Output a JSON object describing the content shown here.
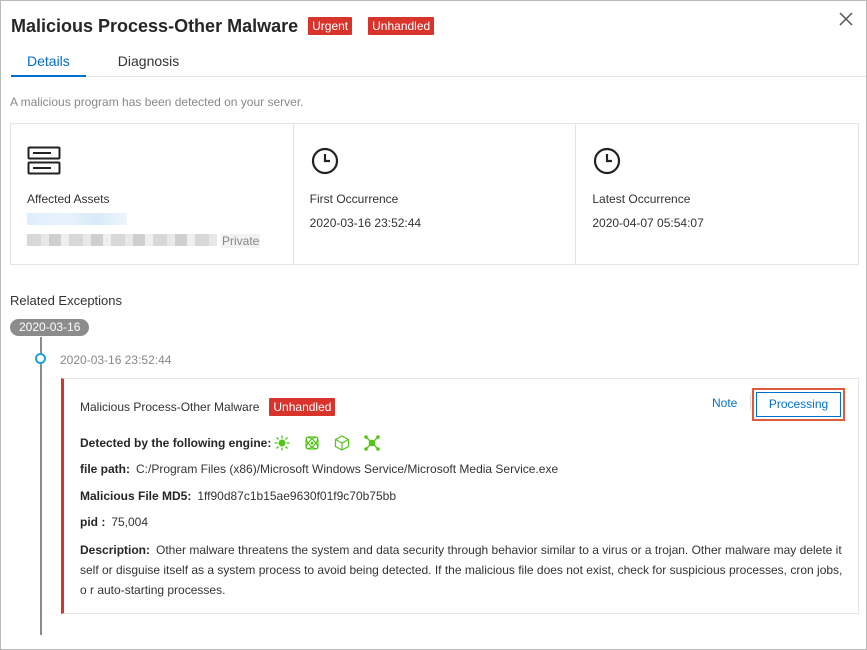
{
  "dialog": {
    "title": "Malicious Process-Other Malware",
    "badges": [
      "Urgent",
      "Unhandled"
    ],
    "close_icon": "close-icon"
  },
  "tabs": [
    {
      "label": "Details",
      "active": true
    },
    {
      "label": "Diagnosis",
      "active": false
    }
  ],
  "description": "A malicious program has been detected on your server.",
  "cards": {
    "affected": {
      "label": "Affected Assets",
      "tag": "Private",
      "icon": "server-icon"
    },
    "first": {
      "label": "First Occurrence",
      "value": "2020-03-16 23:52:44",
      "icon": "clock-icon"
    },
    "latest": {
      "label": "Latest Occurrence",
      "value": "2020-04-07 05:54:07",
      "icon": "clock-icon"
    }
  },
  "related": {
    "title": "Related Exceptions",
    "date": "2020-03-16",
    "timestamp": "2020-03-16 23:52:44"
  },
  "event": {
    "title": "Malicious Process-Other Malware",
    "status": "Unhandled",
    "note_label": "Note",
    "processing_label": "Processing",
    "engine_label": "Detected by the following engine:",
    "file_path_label": "file path:",
    "file_path": "C:/Program Files (x86)/Microsoft Windows Service/Microsoft Media Service.exe",
    "md5_label": "Malicious File MD5:",
    "md5": "1ff90d87c1b15ae9630f01f9c70b75bb",
    "pid_label": "pid :",
    "pid": "75,004",
    "desc_label": "Description:",
    "desc": "Other malware threatens the system and data security through behavior similar to a virus or a trojan. Other malware may delete it self or disguise itself as a system process to avoid being detected. If the malicious file does not exist, check for suspicious processes, cron jobs, o r auto-starting processes.",
    "colors": {
      "accent": "#0070cc",
      "danger": "#d9342b",
      "engine": "#52c41a"
    }
  }
}
